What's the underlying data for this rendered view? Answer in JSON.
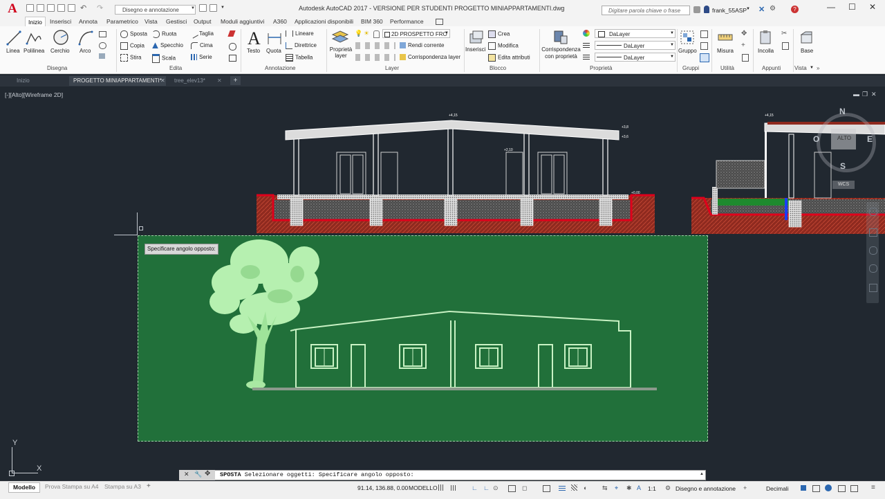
{
  "title_bar": {
    "app_logo": "A",
    "workspace": "Disegno e annotazione",
    "title": "Autodesk AutoCAD 2017 - VERSIONE PER STUDENTI     PROGETTO MINIAPPARTAMENTI.dwg",
    "search_placeholder": "Digitare parola chiave o frase",
    "user": "frank_55ASP"
  },
  "ribbon_tabs": [
    "Inizio",
    "Inserisci",
    "Annota",
    "Parametrico",
    "Vista",
    "Gestisci",
    "Output",
    "Moduli aggiuntivi",
    "A360",
    "Applicazioni disponibili",
    "BIM 360",
    "Performance"
  ],
  "ribbon": {
    "draw": {
      "linea": "Linea",
      "polilinea": "Polilinea",
      "cerchio": "Cerchio",
      "arco": "Arco",
      "title": "Disegna"
    },
    "edit": {
      "sposta": "Sposta",
      "ruota": "Ruota",
      "taglia": "Taglia",
      "copia": "Copia",
      "specchio": "Specchio",
      "cima": "Cima",
      "stira": "Stira",
      "scala": "Scala",
      "serie": "Serie",
      "title": "Edita"
    },
    "annotation": {
      "testo": "Testo",
      "quota": "Quota",
      "lineare": "Lineare",
      "direttrice": "Direttrice",
      "tabella": "Tabella",
      "title": "Annotazione"
    },
    "layer": {
      "proprieta": "Proprietà layer",
      "current_layer": "2D PROSPETTO FRO",
      "rendi_corrente": "Rendi corrente",
      "corrispondenza": "Corrispondenza layer",
      "title": "Layer"
    },
    "block": {
      "inserisci": "Inserisci",
      "crea": "Crea",
      "modifica": "Modifica",
      "edita_attributi": "Edita attributi",
      "title": "Blocco"
    },
    "properties": {
      "corrispondenza": "Corrispondenza con proprietà",
      "layer1": "DaLayer",
      "layer2": "DaLayer",
      "layer3": "DaLayer",
      "title": "Proprietà"
    },
    "groups": {
      "gruppo": "Gruppo",
      "title": "Gruppi"
    },
    "utilities": {
      "misura": "Misura",
      "title": "Utilità"
    },
    "clipboard": {
      "incolla": "Incolla",
      "title": "Appunti"
    },
    "view": {
      "base": "Base",
      "title": "Vista"
    }
  },
  "doc_tabs": [
    "Inizio",
    "PROGETTO MINIAPPARTAMENTI*",
    "tree_elev13*"
  ],
  "viewport_label": "[-][Alto][Wireframe 2D]",
  "viewcube": {
    "n": "N",
    "s": "S",
    "e": "E",
    "o": "O",
    "top": "ALTO",
    "wcs": "WCS"
  },
  "tooltip": "Specificare angolo opposto:",
  "command": {
    "name": "SPOSTA",
    "text": "Selezionare oggetti: Specificare angolo opposto:"
  },
  "layout_tabs": [
    "Modello",
    "Prova Stampa su A4",
    "Stampa su A3"
  ],
  "status": {
    "coords": "91.14, 136.88, 0.00",
    "space": "MODELLO",
    "scale": "1:1",
    "workspace": "Disegno e annotazione",
    "units": "Decimali"
  },
  "ucs": {
    "x": "X",
    "y": "Y"
  },
  "colors": {
    "canvas": "#212830",
    "selection": "#21703a",
    "autocad_red": "#d0021b"
  }
}
